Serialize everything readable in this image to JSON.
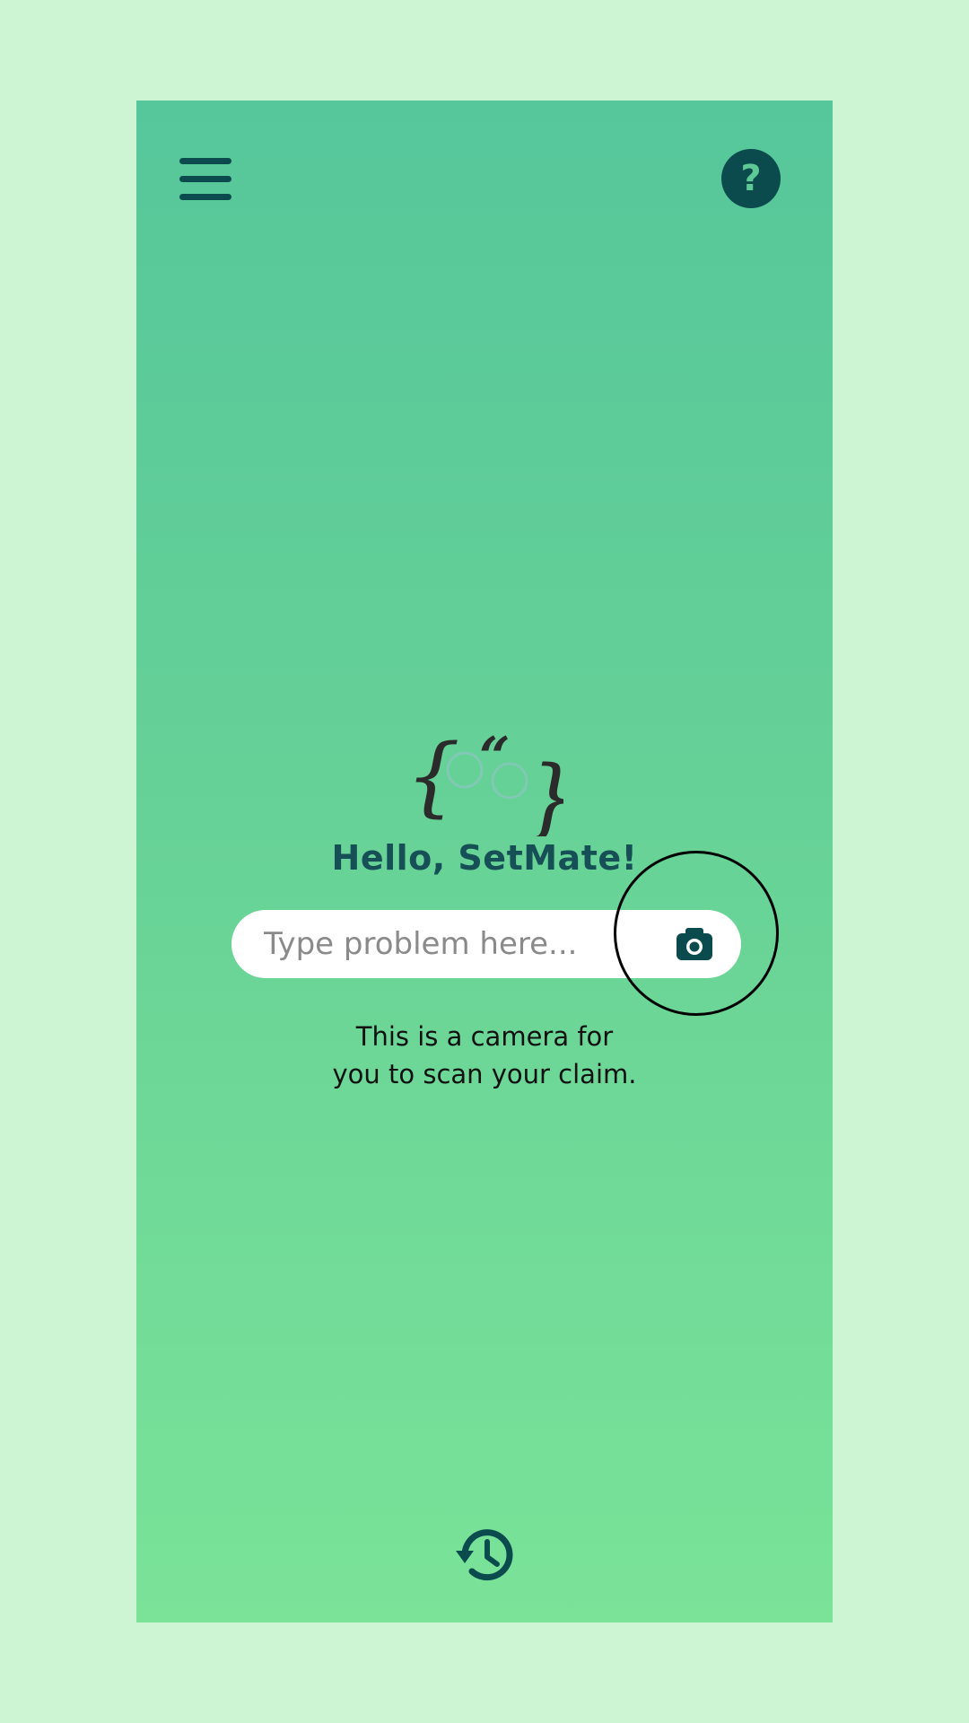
{
  "header": {
    "menu_icon": "hamburger-menu-icon",
    "help_icon": "question-mark-icon",
    "help_label": "?"
  },
  "main": {
    "logo_icon": "braces-quote-eyes-logo",
    "greeting": "Hello, SetMate!",
    "search": {
      "placeholder": "Type problem here...",
      "value": "",
      "camera_icon": "camera-icon"
    },
    "tooltip": "This is a camera for you to scan your claim."
  },
  "footer": {
    "history_icon": "history-clock-icon"
  },
  "colors": {
    "page_background": "#cdf4d3",
    "gradient_top": "#56c79b",
    "gradient_bottom": "#7ae398",
    "accent_dark": "#0b4b4d",
    "greeting_text": "#164f56",
    "search_bg": "#ffffff"
  }
}
